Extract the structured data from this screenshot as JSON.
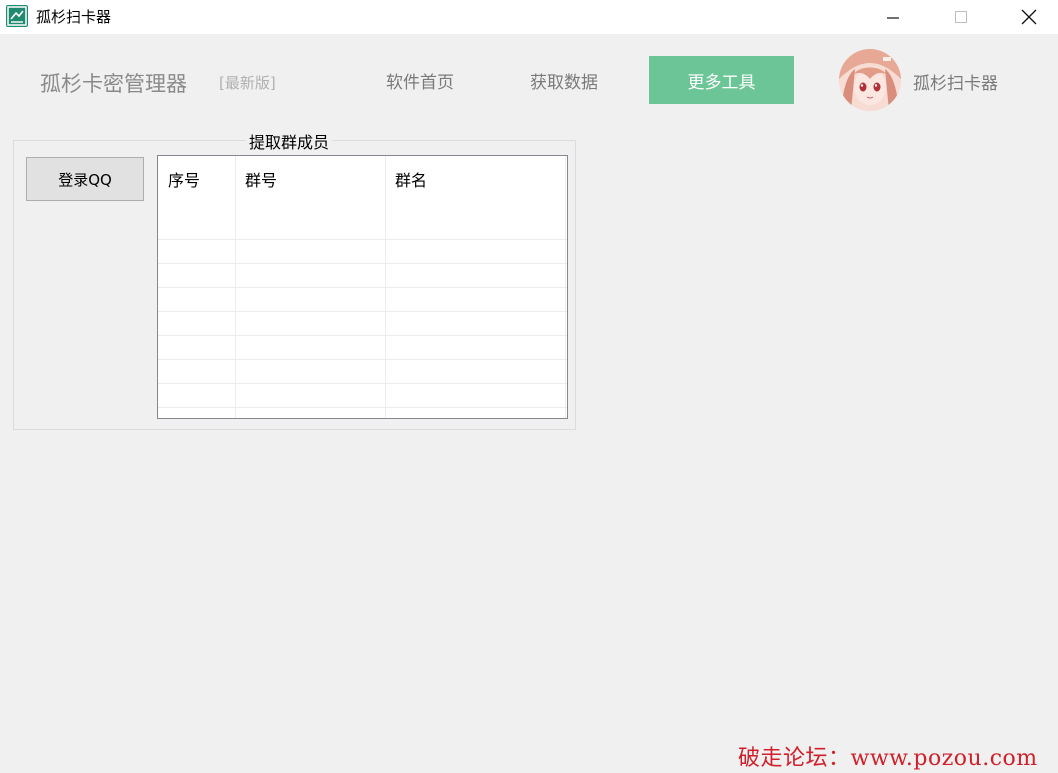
{
  "window": {
    "title": "孤杉扫卡器",
    "controls": {
      "minimize": "—",
      "maximize": "☐",
      "close": "✕"
    }
  },
  "nav": {
    "brand": "孤杉卡密管理器",
    "brand_tag": "[最新版]",
    "items": [
      {
        "label": "软件首页",
        "active": false
      },
      {
        "label": "获取数据",
        "active": false
      },
      {
        "label": "更多工具",
        "active": true
      }
    ],
    "user": {
      "name": "孤杉扫卡器",
      "avatar_icon": "anime-avatar"
    },
    "active_color": "#6cc597"
  },
  "group": {
    "title": "提取群成员",
    "login_button": "登录QQ",
    "table": {
      "columns": [
        "序号",
        "群号",
        "群名"
      ],
      "rows": []
    }
  },
  "watermark": "破走论坛：www.pozou.com"
}
